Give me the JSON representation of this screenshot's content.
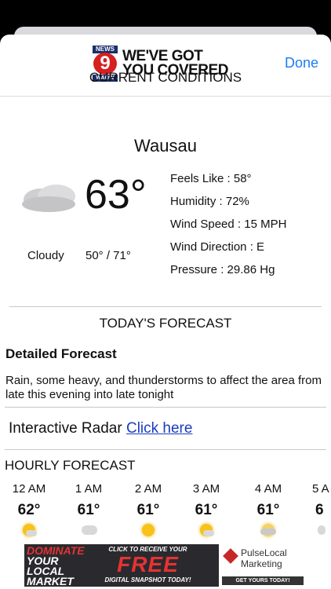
{
  "header": {
    "logo": {
      "badge_top": "NEWS",
      "badge_number": "9",
      "badge_bottom": "WAOW",
      "tagline_line1": "WE'VE GOT",
      "tagline_line2": "YOU COVERED"
    },
    "done_label": "Done"
  },
  "current": {
    "section_title": "CURRENT CONDITIONS",
    "city": "Wausau",
    "temperature": "63°",
    "icon": "cloud-icon",
    "condition": "Cloudy",
    "low_high": "50° / 71°",
    "details": [
      {
        "label": "Feels Like :",
        "value": "58°"
      },
      {
        "label": "Humidity :",
        "value": "72%"
      },
      {
        "label": "Wind Speed :",
        "value": "15 MPH"
      },
      {
        "label": "Wind Direction :",
        "value": "E"
      },
      {
        "label": "Pressure :",
        "value": "29.86 Hg"
      }
    ]
  },
  "today": {
    "section_title": "TODAY'S FORECAST",
    "detailed_title": "Detailed Forecast",
    "detailed_text": "Rain, some heavy, and thunderstorms to affect the area from late this evening into late tonight"
  },
  "radar": {
    "label": "Interactive Radar",
    "link_text": "Click here"
  },
  "hourly": {
    "title": "HOURLY FORECAST",
    "items": [
      {
        "time": "12 AM",
        "temp": "62°",
        "icon": "partly-sunny-icon"
      },
      {
        "time": "1 AM",
        "temp": "61°",
        "icon": "rain-cloud-icon"
      },
      {
        "time": "2 AM",
        "temp": "61°",
        "icon": "sun-icon"
      },
      {
        "time": "3 AM",
        "temp": "61°",
        "icon": "partly-sunny-icon"
      },
      {
        "time": "4 AM",
        "temp": "61°",
        "icon": "sun-cloud-icon"
      },
      {
        "time": "5 A",
        "temp": "6",
        "icon": "rain-icon"
      }
    ]
  },
  "ad": {
    "left_line1": "DOMINATE",
    "left_line2": "YOUR",
    "left_line3": "LOCAL",
    "left_line4": "MARKET",
    "mid_top": "CLICK TO RECEIVE YOUR",
    "mid_big": "FREE",
    "mid_bottom": "DIGITAL SNAPSHOT TODAY!",
    "brand_line1": "PulseLocal",
    "brand_line2": "Marketing",
    "cta": "GET YOURS TODAY!"
  }
}
